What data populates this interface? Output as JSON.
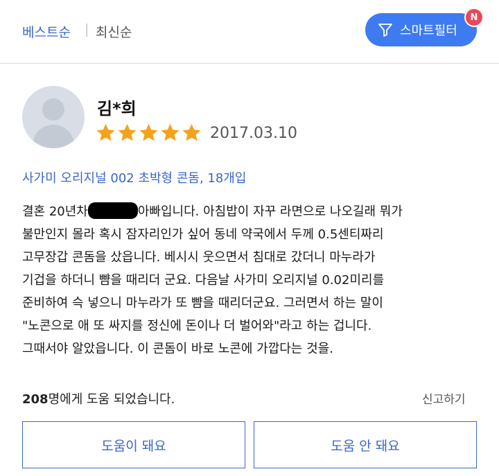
{
  "sort": {
    "best_label": "베스트순",
    "separator": "|",
    "newest_label": "최신순"
  },
  "smart_filter": {
    "label": "스마트필터",
    "badge": "N"
  },
  "review": {
    "reviewer_name": "김*희",
    "rating": 5,
    "rating_max": 5,
    "date": "2017.03.10",
    "product": "사가미 오리지널 002 초박형 콘돔, 18개입",
    "body_line1_pre": "결혼 20년차",
    "body_line1_post": "아빠입니다.  아침밥이 자꾸 라면으로 나오길래 뭐가",
    "body_lines": [
      "불만인지 몰라  혹시 잠자리인가 싶어 동네  약국에서 두께 0.5센티짜리",
      "고무장갑 콘돔을 샀읍니다. 베시시 웃으면서 침대로 갔더니 마누라가",
      "기겁을 하더니 뺨을 때리더 군요. 다음날 사가미 오리지널 0.02미리를",
      "준비하여 슥 넣으니 마누라가 또 뺨을 때리더군요. 그러면서 하는 말이",
      "\"노콘으로 애 또 싸지를 정신에 돈이나 더 벌어와\"라고 하는 겁니다.",
      "그때서야 알았읍니다. 이 콘돔이 바로 노콘에 가깝다는 것을."
    ],
    "helpful_count": "208",
    "helpful_suffix": "명에게 도움 되었습니다.",
    "report_label": "신고하기"
  },
  "buttons": {
    "helpful_yes": "도움이 돼요",
    "helpful_no": "도움 안 돼요"
  },
  "colors": {
    "accent": "#3a66c8",
    "filter_button": "#3e7bf0",
    "badge": "#e8495a",
    "star": "#f5a21b"
  }
}
